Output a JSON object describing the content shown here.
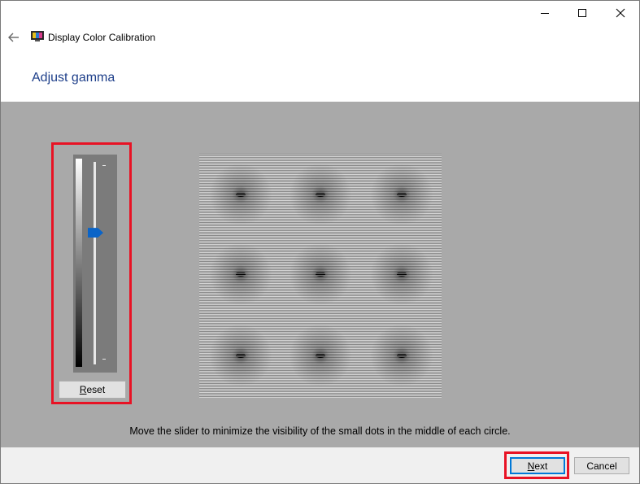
{
  "window": {
    "title": "Display Color Calibration",
    "controls": {
      "minimize_icon": "minimize-icon",
      "maximize_icon": "maximize-icon",
      "close_icon": "close-icon"
    }
  },
  "header": {
    "back_icon": "back-arrow-icon",
    "app_icon": "display-icon",
    "heading": "Adjust gamma"
  },
  "gamma": {
    "slider_level": 0.65,
    "reset_label": "Reset",
    "reset_accesskey": "R"
  },
  "instruction": "Move the slider to minimize the visibility of the small dots in the middle of each circle.",
  "footer": {
    "next_label": "Next",
    "cancel_label": "Cancel"
  },
  "colors": {
    "highlight": "#e81224",
    "accent": "#0a64c8",
    "heading": "#1e3f8a",
    "panel_background": "#a9a9a9"
  }
}
